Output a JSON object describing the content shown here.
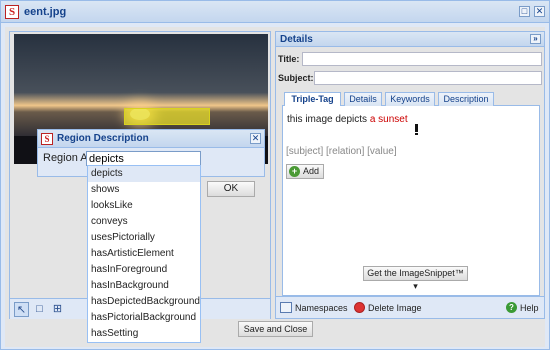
{
  "window": {
    "title": "eent.jpg",
    "maximize_glyph": "□",
    "close_glyph": "✕"
  },
  "region_dialog": {
    "title": "Region Description",
    "label": "Region A",
    "input_value": "depicts",
    "ok_label": "OK",
    "close_glyph": "✕"
  },
  "suggestions": [
    "depicts",
    "shows",
    "looksLike",
    "conveys",
    "usesPictorially",
    "hasArtisticElement",
    "hasInForeground",
    "hasInBackground",
    "hasDepictedBackground",
    "hasPictorialBackground",
    "hasSetting"
  ],
  "details": {
    "header": "Details",
    "collapse_glyph": "»",
    "title_label": "Title:",
    "subject_label": "Subject:",
    "tabs": [
      "Triple-Tag",
      "Details",
      "Keywords",
      "Description"
    ],
    "tag_text_prefix": "this image depicts",
    "tag_text_value": "a sunset",
    "hint": "[subject] [relation] [value]",
    "add_label": "Add",
    "add_glyph": "+",
    "snippet_button": "Get the ImageSnippet™ ▾",
    "footer": {
      "namespaces": "Namespaces",
      "delete": "Delete Image",
      "help": "Help",
      "help_glyph": "?"
    }
  },
  "image_toolbar": {
    "tool_glyphs": [
      "↖",
      "□",
      "⊞"
    ]
  },
  "app_icon_glyph": "S",
  "save_button": "Save and Close",
  "colors": {
    "region_highlight": "#f0e628",
    "accent": "#15428b",
    "tag_value": "#cc0000"
  }
}
